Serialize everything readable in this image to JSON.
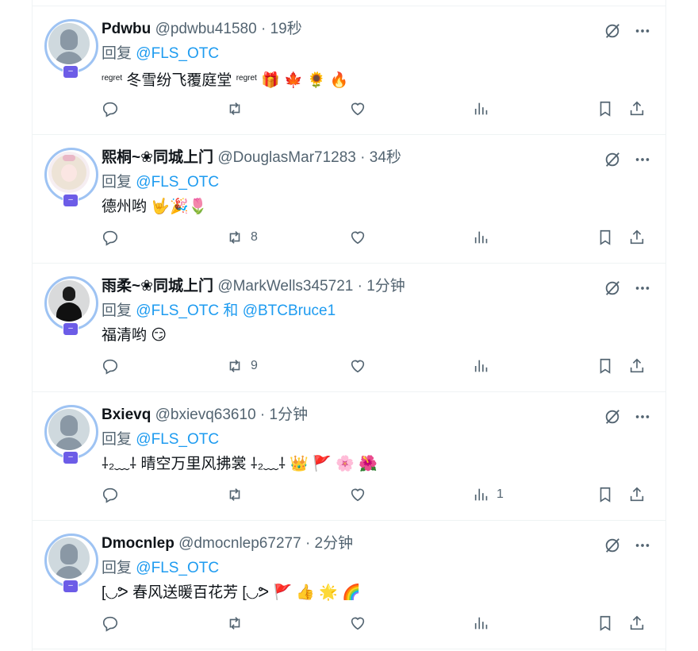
{
  "reply_prefix": "回复",
  "and_word": "和",
  "badge_glyph": "–",
  "colors": {
    "mention": "#1d9bf0",
    "secondary_text": "#536471",
    "avatar_ring": "#9ec3f3",
    "badge": "#6c5ce7"
  },
  "tweets": [
    {
      "name": "Pdwbu",
      "handle": "@pdwbu41580",
      "dot": "·",
      "time": "19秒",
      "mention1": "@FLS_OTC",
      "mention2": "",
      "content_prefix": "regret",
      "content": "冬雪纷飞覆庭堂",
      "content_suffix": "regret",
      "content_emoji": "🎁 🍁 🌻 🔥",
      "avatar": "default",
      "retweet_count": "",
      "view_count": ""
    },
    {
      "name": "熙桐~❀同城上门",
      "handle": "@DouglasMar71283",
      "dot": "·",
      "time": "34秒",
      "mention1": "@FLS_OTC",
      "mention2": "",
      "content_prefix": "",
      "content": "德州哟",
      "content_suffix": "",
      "content_emoji": "🤟🎉🌷",
      "avatar": "anime",
      "retweet_count": "8",
      "view_count": ""
    },
    {
      "name": "雨柔~❀同城上门",
      "handle": "@MarkWells345721",
      "dot": "·",
      "time": "1分钟",
      "mention1": "@FLS_OTC",
      "mention2": "@BTCBruce1",
      "content_prefix": "",
      "content": "福清哟",
      "content_suffix": "",
      "content_emoji": "😏",
      "avatar": "person",
      "retweet_count": "9",
      "view_count": ""
    },
    {
      "name": "Bxievq",
      "handle": "@bxievq63610",
      "dot": "·",
      "time": "1分钟",
      "mention1": "@FLS_OTC",
      "mention2": "",
      "content_prefix": "⸸₂﹏⸸",
      "content": "晴空万里风拂裳",
      "content_suffix": "⸸₂﹏⸸",
      "content_emoji": "👑 🚩 🌸 🌺",
      "avatar": "default",
      "retweet_count": "",
      "view_count": "1"
    },
    {
      "name": "Dmocnlep",
      "handle": "@dmocnlep67277",
      "dot": "·",
      "time": "2分钟",
      "mention1": "@FLS_OTC",
      "mention2": "",
      "content_prefix": "[◟◞ᕗ",
      "content": "春风送暖百花芳",
      "content_suffix": "[◟◞ᕗ",
      "content_emoji": "🚩 👍 🌟 🌈",
      "avatar": "default",
      "retweet_count": "",
      "view_count": ""
    }
  ]
}
